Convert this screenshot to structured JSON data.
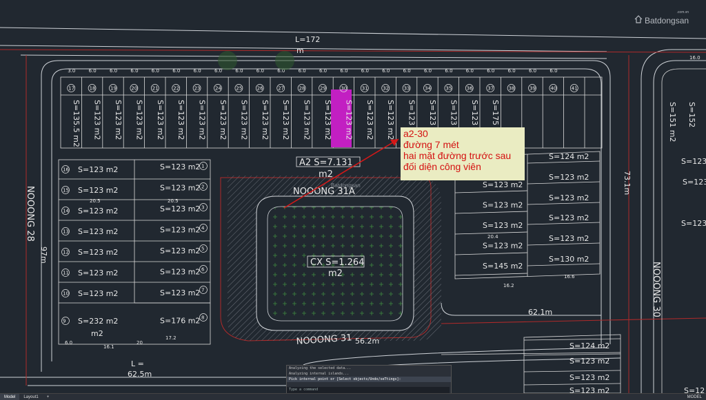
{
  "watermark": {
    "brand": "Batdongsan",
    "sub": ".com.vn",
    "center_text": "Batdongsan"
  },
  "annotation": {
    "lines": [
      "a2-30",
      "đường 7 mét",
      "hai mặt đường trước sau",
      "đối diện công viên"
    ]
  },
  "plan": {
    "top_length": "L=172",
    "top_unit": "m",
    "top_row_widths": [
      "3.0",
      "6.0",
      "6.0",
      "6.0",
      "6.0",
      "6.0",
      "6.0",
      "6.0",
      "6.0",
      "6.0",
      "6.0",
      "6.0",
      "6.0",
      "6.0",
      "6.0",
      "6.0",
      "6.0",
      "6.0",
      "6.0",
      "6.0",
      "6.0",
      "6.0",
      "6.0",
      "6.0"
    ],
    "top_row_ids": [
      "17",
      "18",
      "19",
      "20",
      "21",
      "22",
      "23",
      "24",
      "25",
      "26",
      "27",
      "28",
      "29",
      "30",
      "31",
      "32",
      "33",
      "34",
      "35",
      "36",
      "37",
      "38",
      "39",
      "40",
      "41"
    ],
    "top_row_areas": [
      "S=135.5 m2",
      "S=123 m2",
      "S=123 m2",
      "S=123 m2",
      "S=123 m2",
      "S=123 m2",
      "S=123 m2",
      "S=123 m2",
      "S=123 m2",
      "S=123 m2",
      "S=123 m2",
      "S=123 m2",
      "S=123 m2",
      "S=123 m2",
      "S=123 m2",
      "S=123 m2",
      "S=123 m2",
      "S=123 m2",
      "S=123 m2",
      "S=123 m2",
      "S=175 m2"
    ],
    "block_label": "A2 S=7.131",
    "block_unit": "m2",
    "road_31a": "NOOONG 31A",
    "road_31": "NOOONG 31",
    "road_28": "NOOONG 28",
    "road_30": "NOOONG 30",
    "park_label": "CX S=1.264",
    "park_unit": "m2",
    "left_block": {
      "ids": [
        "16",
        "15",
        "14",
        "13",
        "12",
        "11",
        "10",
        "9"
      ],
      "areas": [
        "S=123 m2",
        "S=123 m2",
        "S=123 m2",
        "S=123 m2",
        "S=123 m2",
        "S=123 m2",
        "S=123 m2",
        "S=232 m2"
      ],
      "unit": "m2",
      "dim_a": "20.5",
      "dim_b": "16.1",
      "dim_c": "6.0",
      "len": "97m"
    },
    "mid_block": {
      "ids": [
        "1",
        "2",
        "3",
        "4",
        "5",
        "6",
        "7",
        "8"
      ],
      "areas": [
        "S=123 m2",
        "S=123 m2",
        "S=123 m2",
        "S=123 m2",
        "S=123 m2",
        "S=123 m2",
        "S=123 m2",
        "S=176 m2"
      ],
      "dim_a": "20.5",
      "dim_b": "17.2",
      "dim_c": "20"
    },
    "right_block": {
      "areas": [
        "S=123 m2",
        "S=123 m2",
        "S=123 m2",
        "S=123 m2",
        "S=145 m2"
      ],
      "areas2": [
        "S=124 m2",
        "S=123 m2",
        "S=123 m2",
        "S=123 m2",
        "S=123 m2",
        "S=130 m2"
      ],
      "dims": [
        "20.4",
        "16.2",
        "16.6"
      ]
    },
    "lengths": {
      "bottom_left": "62.5m",
      "bottom_mid": "56.2m",
      "right_mid": "62.1m",
      "right_side": "73.1m",
      "left_l": "L ="
    },
    "bottom_right": [
      "S=124 m2",
      "S=123 m2",
      "S=123 m2",
      "S=123 m2"
    ],
    "far_right": [
      "S=151 m2",
      "S=152",
      "S=123",
      "S=123",
      "S=123 m2",
      "S=12"
    ],
    "far_right_num": "16.0"
  },
  "command_line": {
    "lines": [
      "Analyzing the selected data...",
      "Analyzing internal islands...",
      "Pick internal point or [Select objects/Undo/seTtings]:"
    ],
    "prompt": "Type a command"
  },
  "status_bar": {
    "tabs": [
      "Model",
      "Layout1",
      "+"
    ],
    "mode": "MODEL"
  }
}
